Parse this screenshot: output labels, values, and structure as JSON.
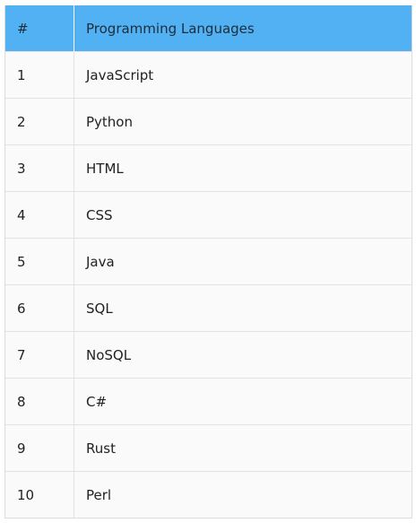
{
  "table": {
    "headers": [
      "#",
      "Programming Languages"
    ],
    "rows": [
      {
        "num": "1",
        "lang": "JavaScript"
      },
      {
        "num": "2",
        "lang": "Python"
      },
      {
        "num": "3",
        "lang": "HTML"
      },
      {
        "num": "4",
        "lang": "CSS"
      },
      {
        "num": "5",
        "lang": "Java"
      },
      {
        "num": "6",
        "lang": "SQL"
      },
      {
        "num": "7",
        "lang": "NoSQL"
      },
      {
        "num": "8",
        "lang": "C#"
      },
      {
        "num": "9",
        "lang": "Rust"
      },
      {
        "num": "10",
        "lang": "Perl"
      }
    ]
  },
  "colors": {
    "header_bg": "#51b1f2",
    "row_bg": "#fafafa",
    "border": "#e2e2e2"
  }
}
